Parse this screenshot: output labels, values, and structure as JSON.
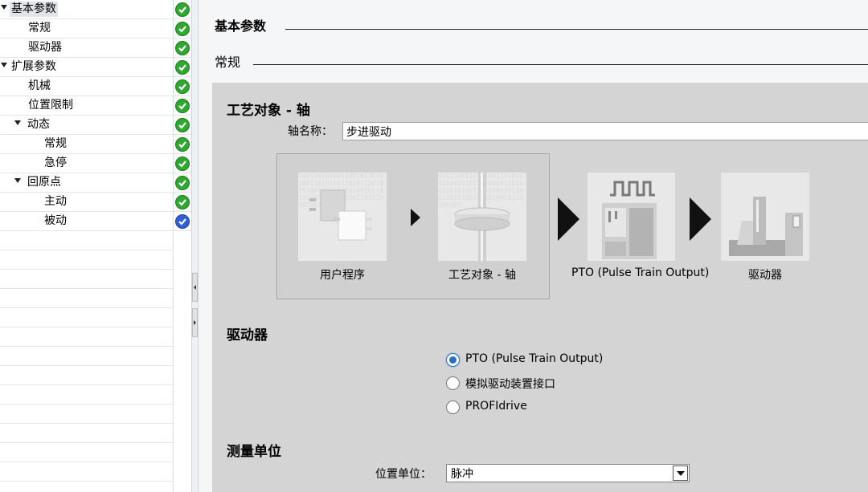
{
  "tree": {
    "items": [
      {
        "label": "基本参数",
        "expanded": true,
        "selected": true,
        "status": "ok"
      },
      {
        "label": "常规",
        "status": "ok"
      },
      {
        "label": "驱动器",
        "status": "ok"
      },
      {
        "label": "扩展参数",
        "expanded": true,
        "status": "ok"
      },
      {
        "label": "机械",
        "status": "ok"
      },
      {
        "label": "位置限制",
        "status": "ok"
      },
      {
        "label": "动态",
        "expanded": true,
        "status": "ok"
      },
      {
        "label": "常规",
        "status": "ok"
      },
      {
        "label": "急停",
        "status": "ok"
      },
      {
        "label": "回原点",
        "expanded": true,
        "status": "ok"
      },
      {
        "label": "主动",
        "status": "ok"
      },
      {
        "label": "被动",
        "status": "ok-blue"
      }
    ]
  },
  "main": {
    "section_title": "基本参数",
    "subsection_title": "常规",
    "panel_title": "工艺对象 - 轴",
    "axis_name_label": "轴名称：",
    "axis_name_value": "步进驱动",
    "flow": {
      "user_program": "用户程序",
      "tech_object": "工艺对象 - 轴",
      "pto": "PTO (Pulse Train Output)",
      "drive": "驱动器"
    },
    "drive_section": {
      "title": "驱动器",
      "options": [
        {
          "label": "PTO (Pulse Train Output)",
          "checked": true
        },
        {
          "label": "模拟驱动装置接口",
          "checked": false
        },
        {
          "label": "PROFIdrive",
          "checked": false
        }
      ]
    },
    "measure_section": {
      "title": "测量单位",
      "position_unit_label": "位置单位：",
      "position_unit_value": "脉冲"
    }
  },
  "colors": {
    "check_green": "#2ea82e",
    "check_blue": "#2f5fd6",
    "panel_bg": "#d4d4d4",
    "radio_accent": "#2b6fc2"
  }
}
